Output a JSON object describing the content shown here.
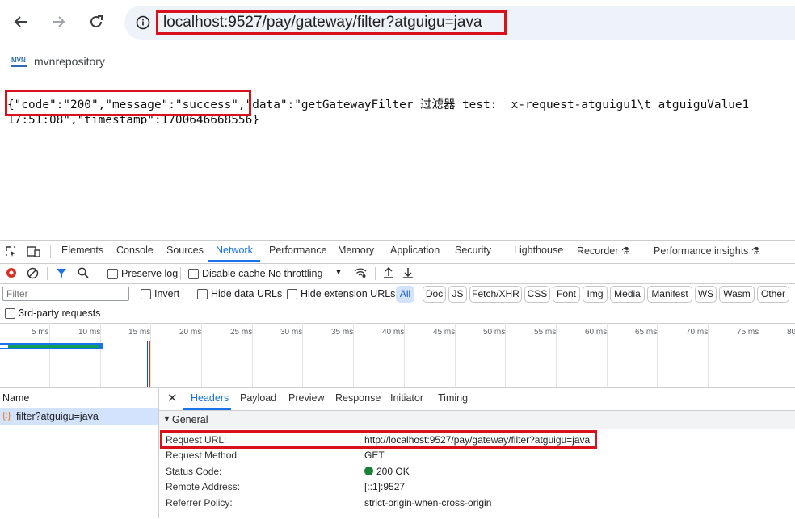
{
  "browser": {
    "url": "localhost:9527/pay/gateway/filter?atguigu=java",
    "bookmark": "mvnrepository"
  },
  "page": {
    "json_line1": "{\"code\":\"200\",\"message\":\"success\",\"data\":\"getGatewayFilter 过滤器 test:  x-request-atguigu1\\t atguiguValue1",
    "json_line2": "17:51:08\",\"timestamp\":1700646668556}"
  },
  "devtools": {
    "tabs": [
      "Elements",
      "Console",
      "Sources",
      "Network",
      "Performance",
      "Memory",
      "Application",
      "Security",
      "Lighthouse",
      "Recorder",
      "Performance insights"
    ],
    "active_tab": "Network",
    "toolbar": {
      "preserve_log": "Preserve log",
      "disable_cache": "Disable cache",
      "throttling": "No throttling"
    },
    "filter": {
      "placeholder": "Filter",
      "invert": "Invert",
      "hide_data_urls": "Hide data URLs",
      "hide_extension_urls": "Hide extension URLs",
      "types": [
        "All",
        "Doc",
        "JS",
        "Fetch/XHR",
        "CSS",
        "Font",
        "Img",
        "Media",
        "Manifest",
        "WS",
        "Wasm",
        "Other"
      ],
      "third_party": "3rd-party requests"
    },
    "timeline_ticks": [
      "5 ms",
      "10 ms",
      "15 ms",
      "20 ms",
      "25 ms",
      "30 ms",
      "35 ms",
      "40 ms",
      "45 ms",
      "50 ms",
      "55 ms",
      "60 ms",
      "65 ms",
      "70 ms",
      "75 ms",
      "80"
    ],
    "requests": {
      "header": "Name",
      "rows": [
        "filter?atguigu=java"
      ]
    },
    "detail_tabs": [
      "Headers",
      "Payload",
      "Preview",
      "Response",
      "Initiator",
      "Timing"
    ],
    "active_detail_tab": "Headers",
    "general": {
      "title": "General",
      "rows": [
        {
          "key": "Request URL:",
          "value": "http://localhost:9527/pay/gateway/filter?atguigu=java"
        },
        {
          "key": "Request Method:",
          "value": "GET"
        },
        {
          "key": "Status Code:",
          "value": "200 OK"
        },
        {
          "key": "Remote Address:",
          "value": "[::1]:9527"
        },
        {
          "key": "Referrer Policy:",
          "value": "strict-origin-when-cross-origin"
        }
      ]
    }
  },
  "colors": {
    "highlight": "#d8111d",
    "accent": "#1a73e8",
    "status_ok": "#188038"
  }
}
